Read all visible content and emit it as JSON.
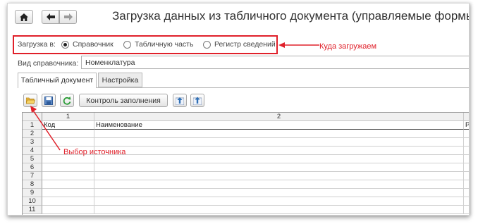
{
  "window": {
    "title": "Загрузка данных из табличного документа (управляемые формы)"
  },
  "nav": {
    "home_icon": "home-icon",
    "back_icon": "arrow-left-icon",
    "forward_icon": "arrow-right-icon"
  },
  "load_into": {
    "label": "Загрузка в:",
    "options": [
      {
        "label": "Справочник",
        "selected": true
      },
      {
        "label": "Табличную часть",
        "selected": false
      },
      {
        "label": "Регистр сведений",
        "selected": false
      }
    ]
  },
  "catalog": {
    "label": "Вид справочника:",
    "value": "Номенклатура"
  },
  "tabs": [
    {
      "label": "Табличный документ",
      "active": true
    },
    {
      "label": "Настройка",
      "active": false
    }
  ],
  "toolbar": {
    "fill_check_label": "Контроль заполнения"
  },
  "sheet": {
    "col_numbers": [
      "1",
      "2"
    ],
    "headers": {
      "row": "1",
      "col1": "Код",
      "col2": "Наименование",
      "col3": "Р"
    },
    "row_numbers": [
      "2",
      "3",
      "4",
      "5",
      "6",
      "7",
      "8",
      "9",
      "10",
      "11"
    ]
  },
  "annotations": {
    "where_to_load": "Куда загружаем",
    "source_choice": "Выбор источника"
  },
  "colors": {
    "annotation_red": "#e0202a",
    "accent_green": "#2e9d3a",
    "accent_blue": "#2f6fb4"
  }
}
